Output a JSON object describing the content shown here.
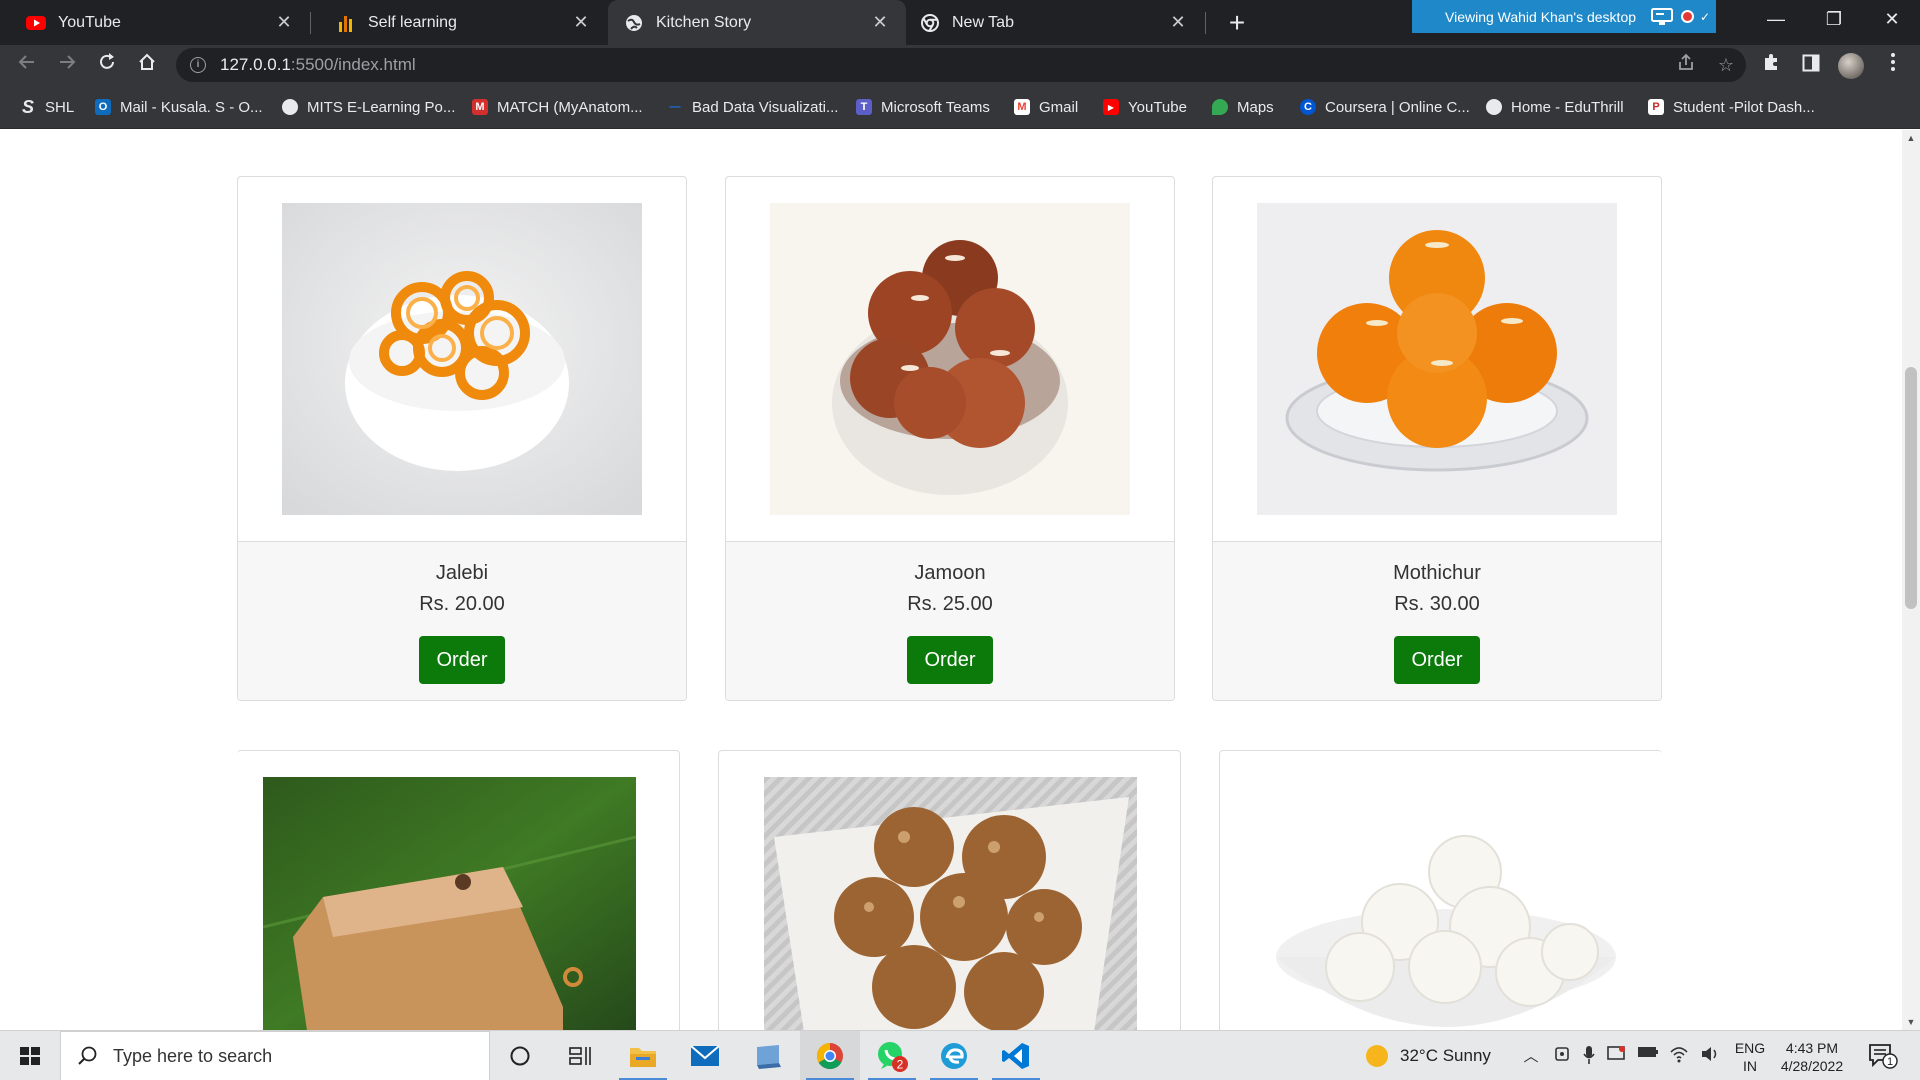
{
  "browser": {
    "tabs": [
      {
        "title": "YouTube",
        "icon": "youtube-icon",
        "active": false
      },
      {
        "title": "Self learning",
        "icon": "bar-chart-icon",
        "active": false
      },
      {
        "title": "Kitchen Story",
        "icon": "globe-icon",
        "active": true
      },
      {
        "title": "New Tab",
        "icon": "chrome-icon",
        "active": false
      }
    ],
    "close_glyph": "✕",
    "new_tab_glyph": "+",
    "share_banner": "Viewing Wahid Khan's desktop",
    "window_controls": {
      "minimize": "—",
      "restore": "❐",
      "close": "✕"
    },
    "url_host": "127.0.0.1",
    "url_path": ":5500/index.html"
  },
  "bookmarks": [
    {
      "label": "SHL",
      "icon": "shl-icon",
      "color": "#3a3a3a"
    },
    {
      "label": "Mail - Kusala. S - O...",
      "icon": "outlook-icon",
      "color": "#0f6cbd"
    },
    {
      "label": "MITS E-Learning Po...",
      "icon": "globe-icon",
      "color": "#5f6368"
    },
    {
      "label": "MATCH (MyAnatom...",
      "icon": "match-icon",
      "color": "#d32f2f"
    },
    {
      "label": "Bad Data Visualizati...",
      "icon": "dash-icon",
      "color": "#1a73e8"
    },
    {
      "label": "Microsoft Teams",
      "icon": "teams-icon",
      "color": "#5b5fc7"
    },
    {
      "label": "Gmail",
      "icon": "gmail-icon",
      "color": "#ea4335"
    },
    {
      "label": "YouTube",
      "icon": "youtube-icon",
      "color": "#ff0000"
    },
    {
      "label": "Maps",
      "icon": "maps-icon",
      "color": "#34a853"
    },
    {
      "label": "Coursera | Online C...",
      "icon": "coursera-icon",
      "color": "#0056d2"
    },
    {
      "label": "Home - EduThrill",
      "icon": "globe-icon",
      "color": "#5f6368"
    },
    {
      "label": "Student -Pilot Dash...",
      "icon": "pilot-icon",
      "color": "#c62828"
    }
  ],
  "products": [
    {
      "name": "Jalebi",
      "price": "Rs. 20.00",
      "order_label": "Order"
    },
    {
      "name": "Jamoon",
      "price": "Rs. 25.00",
      "order_label": "Order"
    },
    {
      "name": "Mothichur",
      "price": "Rs. 30.00",
      "order_label": "Order"
    },
    {
      "name": "",
      "price": "",
      "order_label": ""
    },
    {
      "name": "",
      "price": "",
      "order_label": ""
    },
    {
      "name": "",
      "price": "",
      "order_label": ""
    }
  ],
  "colors": {
    "order_button": "#0b7a0b",
    "share_banner": "#1e88c9"
  },
  "taskbar": {
    "search_placeholder": "Type here to search",
    "weather": "32°C  Sunny",
    "lang_1": "ENG",
    "lang_2": "IN",
    "time": "4:43 PM",
    "date": "4/28/2022",
    "whatsapp_badge": "2",
    "notifications_badge": "1"
  }
}
